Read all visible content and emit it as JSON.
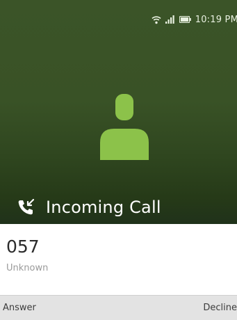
{
  "status_bar": {
    "time": "10:19 PM",
    "icons": [
      "wifi-icon",
      "signal-icon",
      "battery-icon"
    ]
  },
  "call": {
    "title": "Incoming Call",
    "icon": "incoming-call-icon",
    "avatar": "person-icon"
  },
  "caller": {
    "number": "057",
    "label": "Unknown"
  },
  "softkeys": {
    "left": "Answer",
    "right": "Decline"
  },
  "colors": {
    "header_top": "#3b5428",
    "header_bottom": "#20321a",
    "avatar": "#8cc24a",
    "softkey_bar": "#e3e3e3"
  }
}
